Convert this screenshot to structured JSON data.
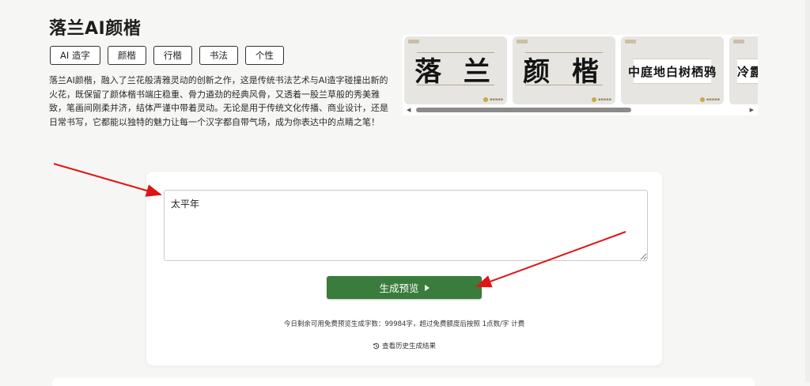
{
  "header": {
    "title": "落兰AI颜楷",
    "tags": [
      "AI 造字",
      "颜楷",
      "行楷",
      "书法",
      "个性"
    ],
    "description": "落兰AI颜楷，融入了兰花般清雅灵动的创新之作，这是传统书法艺术与AI造字碰撞出新的火花，既保留了颜体楷书端庄稳重、骨力遒劲的经典风骨，又透着一股兰草般的秀美雅致，笔画间刚柔并济，结体严谨中带着灵动。无论是用于传统文化传播、商业设计，还是日常书写，它都能以独特的魅力让每一个汉字都自带气场，成为你表达中的点睛之笔！"
  },
  "gallery": {
    "samples": [
      "落 兰",
      "颜 楷",
      "中庭地白树栖鸦",
      "冷露"
    ]
  },
  "form": {
    "input_value": "太平年",
    "generate_label": "生成预览",
    "quota_text": "今日剩余可用免费预览生成字数：99984字，超过免费额度后按照 1点数/字 计费",
    "history_label": "查看历史生成结果"
  },
  "colors": {
    "accent_green": "#3a7c3c",
    "annotation_red": "#e01414"
  }
}
